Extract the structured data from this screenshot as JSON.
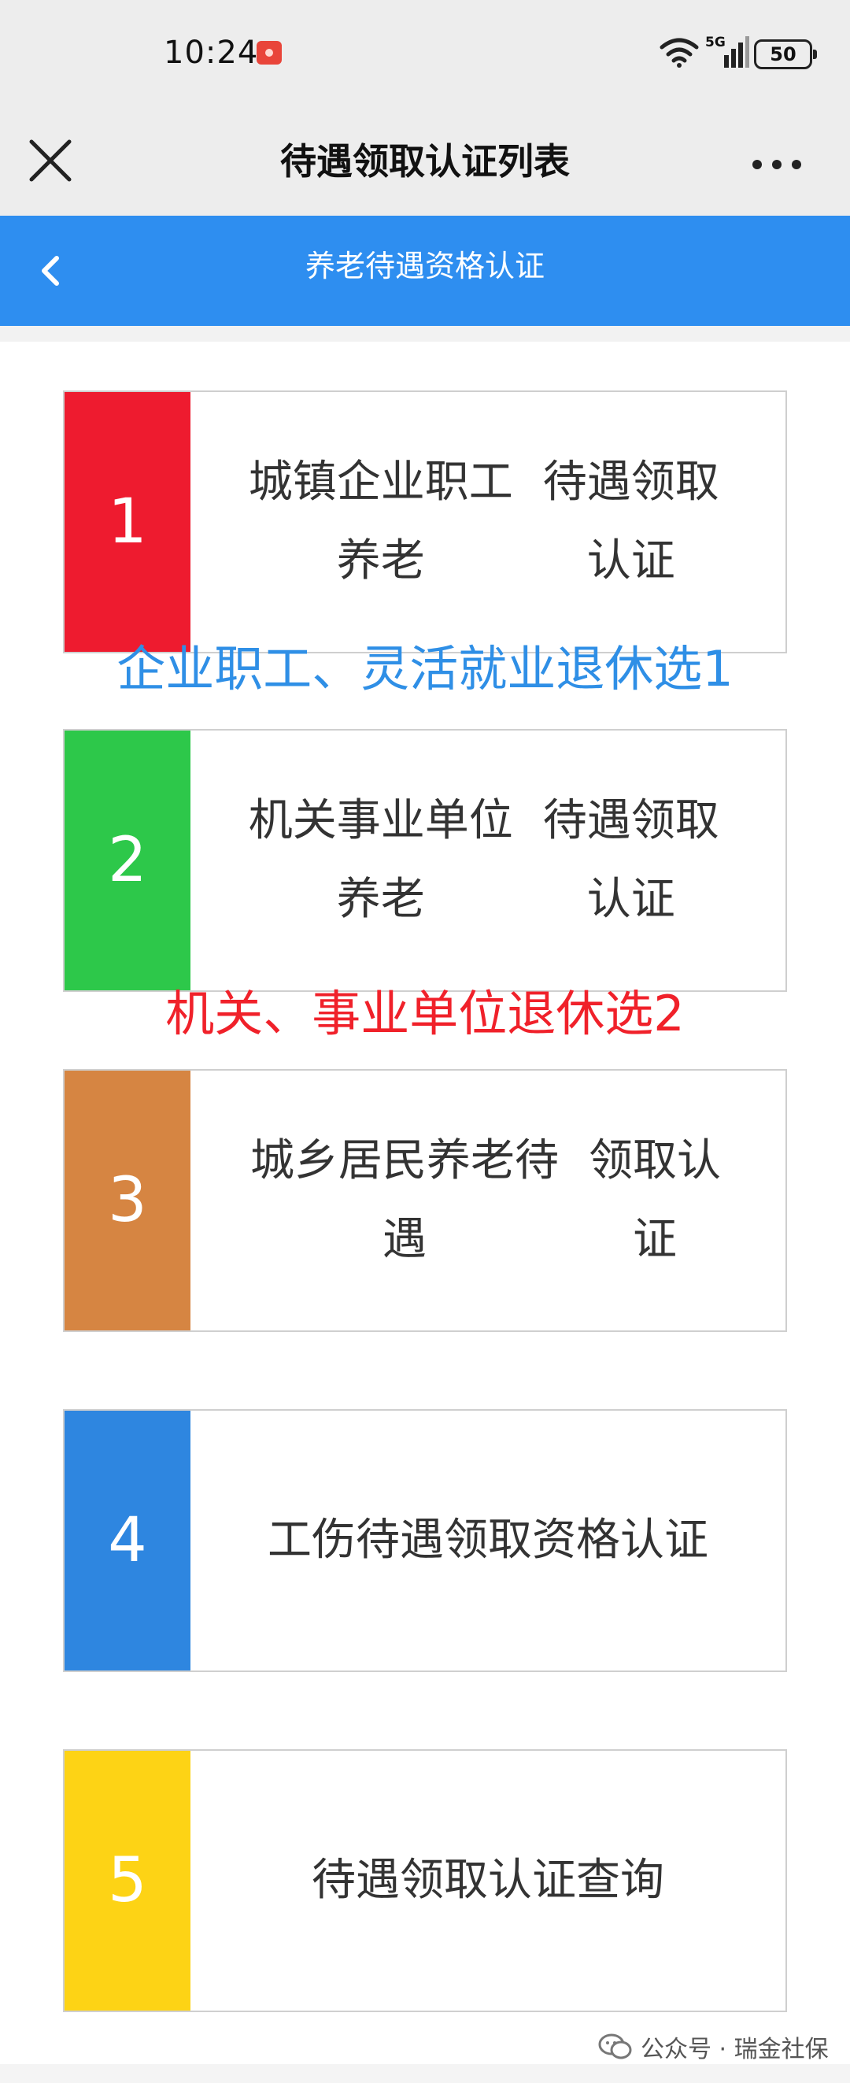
{
  "status_bar": {
    "time": "10:24",
    "network": "5G",
    "battery": "50"
  },
  "title_bar": {
    "title": "待遇领取认证列表"
  },
  "header": {
    "title": "养老待遇资格认证"
  },
  "items": [
    {
      "number": "1",
      "line1": "城镇企业职工养老",
      "line2": "待遇领取认证",
      "color": "#ee1b2f"
    },
    {
      "number": "2",
      "line1": "机关事业单位养老",
      "line2": "待遇领取认证",
      "color": "#2dc84a"
    },
    {
      "number": "3",
      "line1": "城乡居民养老待遇",
      "line2": "领取认证",
      "color": "#d68542"
    },
    {
      "number": "4",
      "line1": "工伤待遇领取资格",
      "line2": "认证",
      "color": "#2e86e0"
    },
    {
      "number": "5",
      "line1": "待遇领取认证查询",
      "line2": "",
      "color": "#fdd315"
    }
  ],
  "annotations": [
    {
      "text": "企业职工、灵活就业退休选1",
      "color": "#2f8fe6"
    },
    {
      "text": "机关、事业单位退休选2",
      "color": "#f0212a"
    }
  ],
  "watermark": {
    "text": "公众号 · 瑞金社保"
  }
}
